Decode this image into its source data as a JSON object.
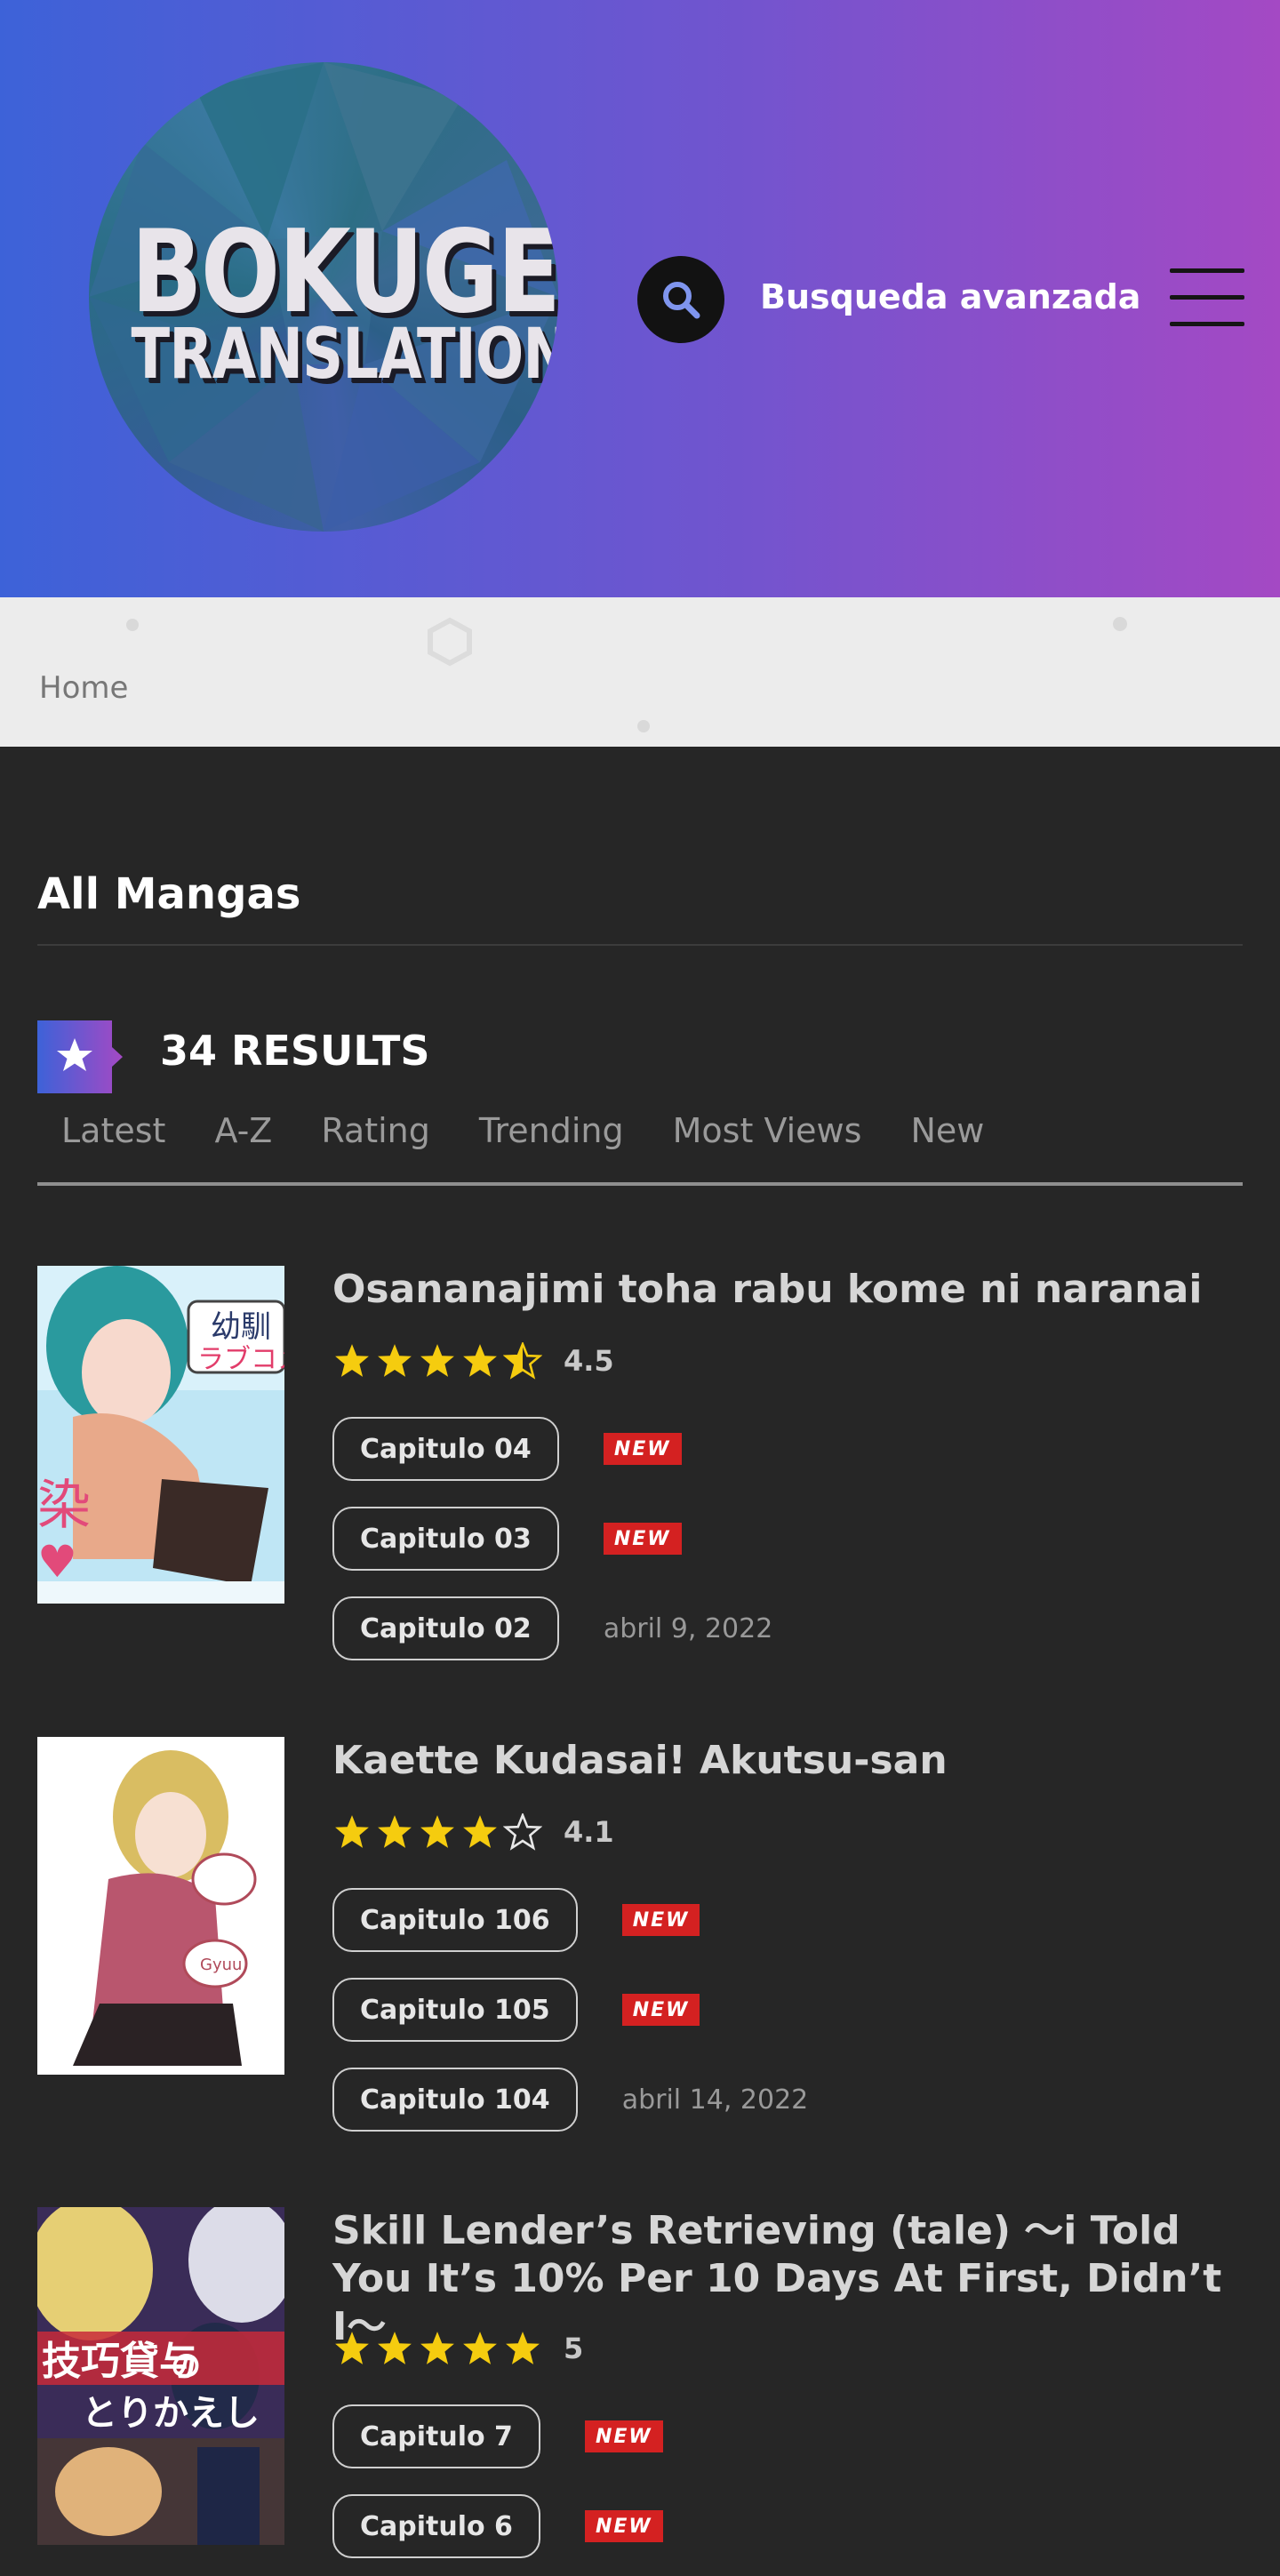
{
  "header": {
    "logo_line1": "BOKUGEN",
    "logo_line2": "TRANSLATION",
    "advanced_search_label": "Busqueda avanzada"
  },
  "breadcrumb": {
    "home": "Home"
  },
  "main": {
    "section_title": "All Mangas",
    "results_label": "34 RESULTS",
    "tabs": [
      "Latest",
      "A-Z",
      "Rating",
      "Trending",
      "Most Views",
      "New"
    ]
  },
  "mangas": [
    {
      "title": "Osananajimi toha rabu kome ni naranai",
      "rating_value": 4.5,
      "score": "4.5",
      "chapters": [
        {
          "label": "Capitulo 04",
          "badge": "NEW",
          "date": ""
        },
        {
          "label": "Capitulo 03",
          "badge": "NEW",
          "date": ""
        },
        {
          "label": "Capitulo 02",
          "badge": "",
          "date": "abril 9, 2022"
        }
      ]
    },
    {
      "title": "Kaette Kudasai! Akutsu-san",
      "rating_value": 4,
      "score": "4.1",
      "chapters": [
        {
          "label": "Capitulo 106",
          "badge": "NEW",
          "date": ""
        },
        {
          "label": "Capitulo 105",
          "badge": "NEW",
          "date": ""
        },
        {
          "label": "Capitulo 104",
          "badge": "",
          "date": "abril 14, 2022"
        }
      ]
    },
    {
      "title": "Skill Lender’s Retrieving (tale) ～i Told You It’s 10% Per 10 Days At First, Didn’t I～",
      "rating_value": 5,
      "score": "5",
      "chapters": [
        {
          "label": "Capitulo 7",
          "badge": "NEW",
          "date": ""
        },
        {
          "label": "Capitulo 6",
          "badge": "NEW",
          "date": ""
        }
      ]
    }
  ],
  "colors": {
    "header_gradient_start": "#3d62d8",
    "header_gradient_end": "#a449c4",
    "star_color": "#f5cc0f",
    "new_badge": "#d42121",
    "background": "#262626"
  },
  "icons": [
    "search-icon",
    "hamburger-menu-icon",
    "star-badge-icon",
    "star-full-icon",
    "star-half-icon",
    "star-empty-icon"
  ]
}
